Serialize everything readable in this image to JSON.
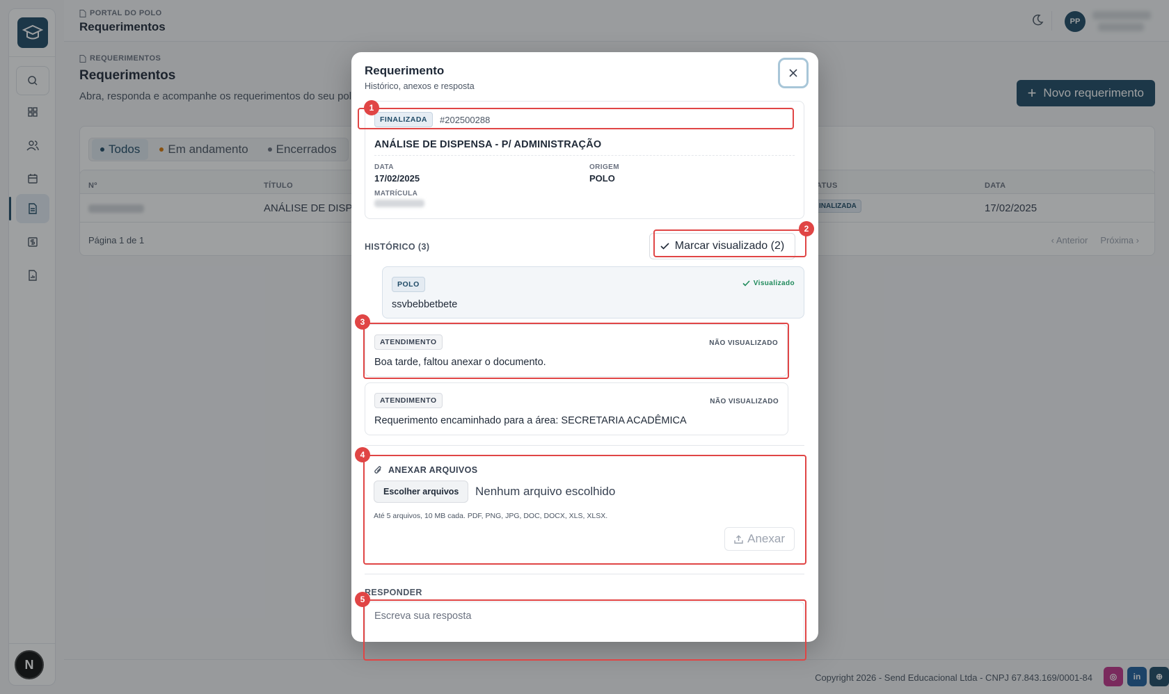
{
  "topbar": {
    "breadcrumb": "PORTAL DO POLO",
    "title": "Requerimentos",
    "avatar_initials": "PP"
  },
  "sidebar": {
    "icons": [
      "search-icon",
      "dashboard-icon",
      "users-icon",
      "calendar-icon",
      "document-icon",
      "finance-icon",
      "report-icon"
    ],
    "bottom_avatar": "N"
  },
  "page": {
    "breadcrumb": "REQUERIMENTOS",
    "title": "Requerimentos",
    "description": "Abra, responda e acompanhe os requerimentos do seu pol",
    "new_button": "Novo requerimento",
    "filters": [
      {
        "label": "Todos",
        "dot_color": "#1f4a66"
      },
      {
        "label": "Em andamento",
        "dot_color": "#d97706"
      },
      {
        "label": "Encerrados",
        "dot_color": "#6b7280"
      }
    ],
    "table": {
      "headers": {
        "num": "Nº",
        "title": "TÍTULO",
        "status": "ATUS",
        "date": "DATA"
      },
      "row": {
        "title": "ANÁLISE DE DISPE",
        "status": "INALIZADA",
        "date": "17/02/2025"
      },
      "pagination": "Página 1 de 1",
      "prev": "Anterior",
      "next": "Próxima"
    }
  },
  "footer": {
    "copyright": "Copyright 2026 - Send Educacional Ltda - CNPJ 67.843.169/0001-84",
    "social": [
      {
        "name": "instagram",
        "label": "◎",
        "color": "#c1358a"
      },
      {
        "name": "linkedin",
        "label": "in",
        "color": "#1f5f9e"
      },
      {
        "name": "website",
        "label": "⊕",
        "color": "#1f4a66"
      }
    ]
  },
  "modal": {
    "title": "Requerimento",
    "subtitle": "Histórico, anexos e resposta",
    "info": {
      "status": "FINALIZADA",
      "number": "#202500288",
      "name": "ANÁLISE DE DISPENSA - P/ ADMINISTRAÇÃO",
      "date_label": "DATA",
      "date": "17/02/2025",
      "origin_label": "ORIGEM",
      "origin": "POLO",
      "matricula_label": "MATRÍCULA"
    },
    "history_label": "HISTÓRICO (3)",
    "mark_seen": "Marcar visualizado (2)",
    "messages": [
      {
        "tag": "POLO",
        "status": "Visualizado",
        "text": "ssvbebbetbete"
      },
      {
        "tag": "ATENDIMENTO",
        "status": "NÃO VISUALIZADO",
        "text": "Boa tarde, faltou anexar o documento."
      },
      {
        "tag": "ATENDIMENTO",
        "status": "NÃO VISUALIZADO",
        "text": "Requerimento encaminhado para a área: SECRETARIA ACADÊMICA"
      }
    ],
    "attach": {
      "label": "ANEXAR ARQUIVOS",
      "choose": "Escolher arquivos",
      "no_file": "Nenhum arquivo escolhido",
      "hint": "Até 5 arquivos, 10 MB cada. PDF, PNG, JPG, DOC, DOCX, XLS, XLSX.",
      "button": "Anexar"
    },
    "reply_label": "RESPONDER",
    "reply_placeholder": "Escreva sua resposta"
  },
  "annotations": [
    "1",
    "2",
    "3",
    "4",
    "5"
  ],
  "colors": {
    "accent": "#1f4a66",
    "highlight": "#e04545",
    "success": "#1f8a5b"
  }
}
